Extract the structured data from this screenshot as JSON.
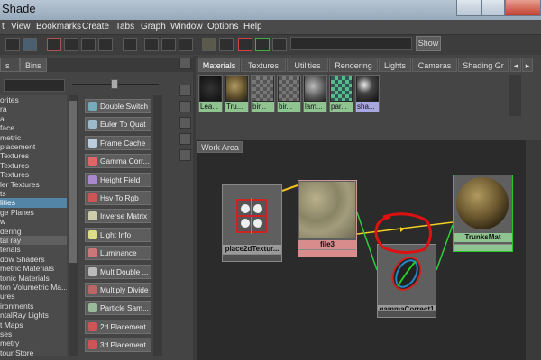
{
  "window": {
    "title": "Shade"
  },
  "menubar": [
    "t",
    "View",
    "Bookmarks",
    "Create",
    "Tabs",
    "Graph",
    "Window",
    "Options",
    "Help"
  ],
  "toolbar": {
    "show_label": "Show",
    "search_value": ""
  },
  "left_panel": {
    "tabs": [
      "s",
      "Bins"
    ],
    "tree": [
      "orites",
      "ra",
      "a",
      "face",
      "metric",
      "placement",
      "Textures",
      "Textures",
      "Textures",
      "ler Textures",
      "ts",
      "lities",
      "ge Planes",
      "w",
      "dering",
      "tal ray",
      "terials",
      "dow Shaders",
      "metric Materials",
      "tonic Materials",
      "ton Volumetric Ma...",
      "ures",
      "ironments",
      "ntalRay Lights",
      "t Maps",
      "ses",
      "metry",
      "tour Store"
    ],
    "tree_selected": "lities",
    "node_buttons": [
      {
        "label": "Double Switch",
        "icon": "double-switch-icon",
        "color": "#7ab"
      },
      {
        "label": "Euler To Quat",
        "icon": "euler-quat-icon",
        "color": "#9bc"
      },
      {
        "label": "Frame Cache",
        "icon": "frame-cache-icon",
        "color": "#bcd"
      },
      {
        "label": "Gamma Corr...",
        "icon": "gamma-correct-icon",
        "color": "#d66"
      },
      {
        "label": "Height Field",
        "icon": "height-field-icon",
        "color": "#a8c"
      },
      {
        "label": "Hsv To Rgb",
        "icon": "hsv-rgb-icon",
        "color": "#c55"
      },
      {
        "label": "Inverse Matrix",
        "icon": "inverse-matrix-icon",
        "color": "#cca"
      },
      {
        "label": "Light Info",
        "icon": "light-info-icon",
        "color": "#dd8"
      },
      {
        "label": "Luminance",
        "icon": "luminance-icon",
        "color": "#c77"
      },
      {
        "label": "Mult Double ...",
        "icon": "mult-double-icon",
        "color": "#bbb"
      },
      {
        "label": "Multiply Divide",
        "icon": "multiply-divide-icon",
        "color": "#b66"
      },
      {
        "label": "Particle Sam...",
        "icon": "particle-sampler-icon",
        "color": "#9b9"
      },
      {
        "label": "2d Placement",
        "icon": "2d-placement-icon",
        "color": "#c55"
      },
      {
        "label": "3d Placement",
        "icon": "3d-placement-icon",
        "color": "#c55"
      }
    ]
  },
  "materials_panel": {
    "tabs": [
      "Materials",
      "Textures",
      "Utilities",
      "Rendering",
      "Lights",
      "Cameras",
      "Shading Gr"
    ],
    "active_tab": "Materials",
    "swatches": [
      {
        "label": "Lea...",
        "kind": "dark"
      },
      {
        "label": "Tru...",
        "kind": "bark"
      },
      {
        "label": "bir...",
        "kind": "checker-birch"
      },
      {
        "label": "bir...",
        "kind": "checker-birch"
      },
      {
        "label": "lam...",
        "kind": "grey-sphere"
      },
      {
        "label": "par...",
        "kind": "checker-teal"
      },
      {
        "label": "sha...",
        "kind": "dark-sphere",
        "selected": true
      }
    ]
  },
  "work_area": {
    "tab": "Work Area",
    "nodes": [
      {
        "id": "place2d",
        "label": "place2dTextur...",
        "color": "#9a9a9a"
      },
      {
        "id": "file3",
        "label": "file3",
        "color": "#d98c8c"
      },
      {
        "id": "gammaCorrect1",
        "label": "gammaCorrect1",
        "color": "#9a9a9a"
      },
      {
        "id": "trunksMat",
        "label": "TrunksMat",
        "color": "#8fc38f"
      }
    ]
  },
  "colors": {
    "accent_select": "#5285a6",
    "connection_green": "#2ecc40",
    "connection_yellow": "#f0d020",
    "annotation_red": "#dd1111"
  }
}
